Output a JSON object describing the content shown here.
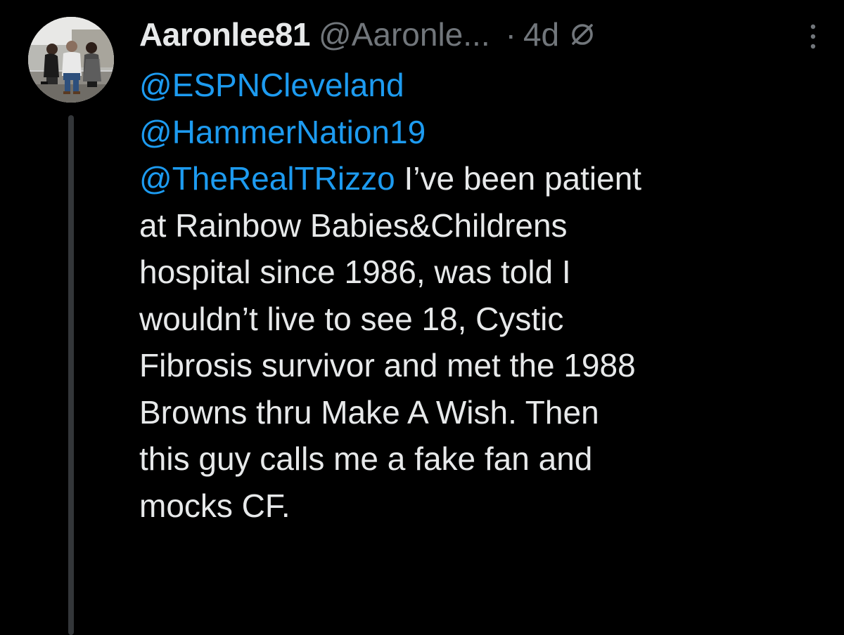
{
  "tweet": {
    "display_name": "Aaronlee81",
    "handle": "@Aaronle...",
    "separator": "·",
    "time": "4d",
    "audience_icon": "restricted-audience-icon",
    "more_icon": "more-vertical-icon",
    "avatar_icon": "profile-photo",
    "mentions": [
      "@ESPNCleveland",
      "@HammerNation19",
      "@TheRealTRizzo"
    ],
    "text_lines": [
      " I’ve been patient",
      "at Rainbow Babies&Childrens",
      "hospital since 1986, was told I",
      "wouldn’t live to see 18, Cystic",
      "Fibrosis survivor and met the 1988",
      "Browns thru Make A Wish. Then",
      "this guy calls me a fake fan and",
      "mocks CF."
    ]
  },
  "colors": {
    "background": "#000000",
    "text": "#e7e9ea",
    "muted": "#71767b",
    "link": "#1d9bf0",
    "thread_line": "#333639"
  }
}
